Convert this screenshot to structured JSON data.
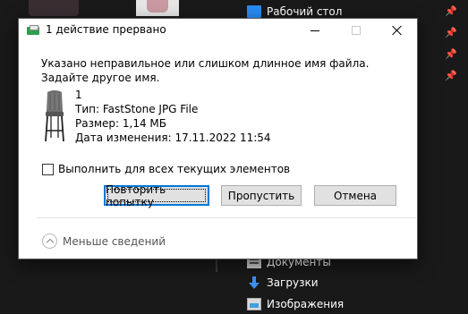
{
  "explorer": {
    "nav_items": [
      {
        "label": "Рабочий стол",
        "icon": "desktop-icon"
      },
      {
        "label": "Документы",
        "icon": "documents-icon"
      },
      {
        "label": "Загрузки",
        "icon": "downloads-icon"
      },
      {
        "label": "Изображения",
        "icon": "pictures-icon"
      }
    ]
  },
  "dialog": {
    "title": "1 действие прервано",
    "message_line1": "Указано неправильное или слишком длинное имя файла.",
    "message_line2": "Задайте другое имя.",
    "file": {
      "name": "1",
      "type": "Тип: FastStone JPG File",
      "size": "Размер: 1,14 МБ",
      "modified": "Дата изменения: 17.11.2022 11:54"
    },
    "apply_all_label": "Выполнить для всех текущих элементов",
    "apply_all_checked": false,
    "buttons": {
      "retry": "Повторить попытку",
      "skip": "Пропустить",
      "cancel": "Отмена"
    },
    "less_details": "Меньше сведений"
  },
  "colors": {
    "accent": "#0078d7",
    "dialog_bg": "#ffffff",
    "explorer_bg": "#191919"
  }
}
